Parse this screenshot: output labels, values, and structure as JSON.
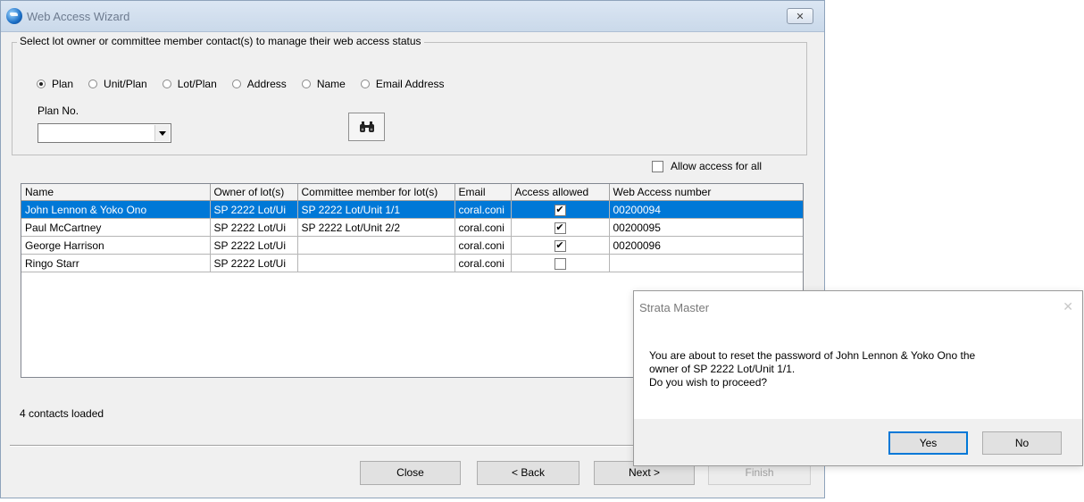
{
  "window": {
    "title": "Web Access Wizard",
    "close_glyph": "✕"
  },
  "search": {
    "group_caption": "Select lot owner or committee member contact(s) to manage their web access status",
    "radio_options": [
      {
        "label": "Plan",
        "checked": true
      },
      {
        "label": "Unit/Plan",
        "checked": false
      },
      {
        "label": "Lot/Plan",
        "checked": false
      },
      {
        "label": "Address",
        "checked": false
      },
      {
        "label": "Name",
        "checked": false
      },
      {
        "label": "Email Address",
        "checked": false
      }
    ],
    "plan_label": "Plan No.",
    "plan_value": "",
    "find_icon": "binoculars-icon",
    "find_glyph": "🔭"
  },
  "allow_all": {
    "label": "Allow access for all",
    "checked": false
  },
  "grid": {
    "columns": [
      "Name",
      "Owner of lot(s)",
      "Committee member for lot(s)",
      "Email",
      "Access allowed",
      "Web Access number"
    ],
    "rows": [
      {
        "name": "John Lennon & Yoko Ono",
        "owner": "SP 2222 Lot/Ui",
        "committee": "SP 2222 Lot/Unit 1/1",
        "email": "coral.coni",
        "access": "✔",
        "number": "00200094"
      },
      {
        "name": "Paul McCartney",
        "owner": "SP 2222 Lot/Ui",
        "committee": "SP 2222 Lot/Unit 2/2",
        "email": "coral.coni",
        "access": "✔",
        "number": "00200095"
      },
      {
        "name": "George Harrison",
        "owner": "SP 2222 Lot/Ui",
        "committee": "",
        "email": "coral.coni",
        "access": "✔",
        "number": "00200096"
      },
      {
        "name": "Ringo Starr",
        "owner": "SP 2222 Lot/Ui",
        "committee": "",
        "email": "coral.coni",
        "access": "",
        "number": ""
      }
    ],
    "selected_row": 0,
    "selection_color": "#0078d7"
  },
  "status": {
    "text": "4 contacts loaded"
  },
  "buttons": {
    "close": "Close",
    "back": "< Back",
    "next": "Next >",
    "finish": "Finish"
  },
  "dialog": {
    "title": "Strata Master",
    "close_glyph": "✕",
    "message_lines": [
      "You are about to reset the password of John Lennon & Yoko Ono the",
      "owner of SP 2222 Lot/Unit 1/1.",
      "Do you wish to proceed?"
    ],
    "yes": "Yes",
    "no": "No"
  }
}
